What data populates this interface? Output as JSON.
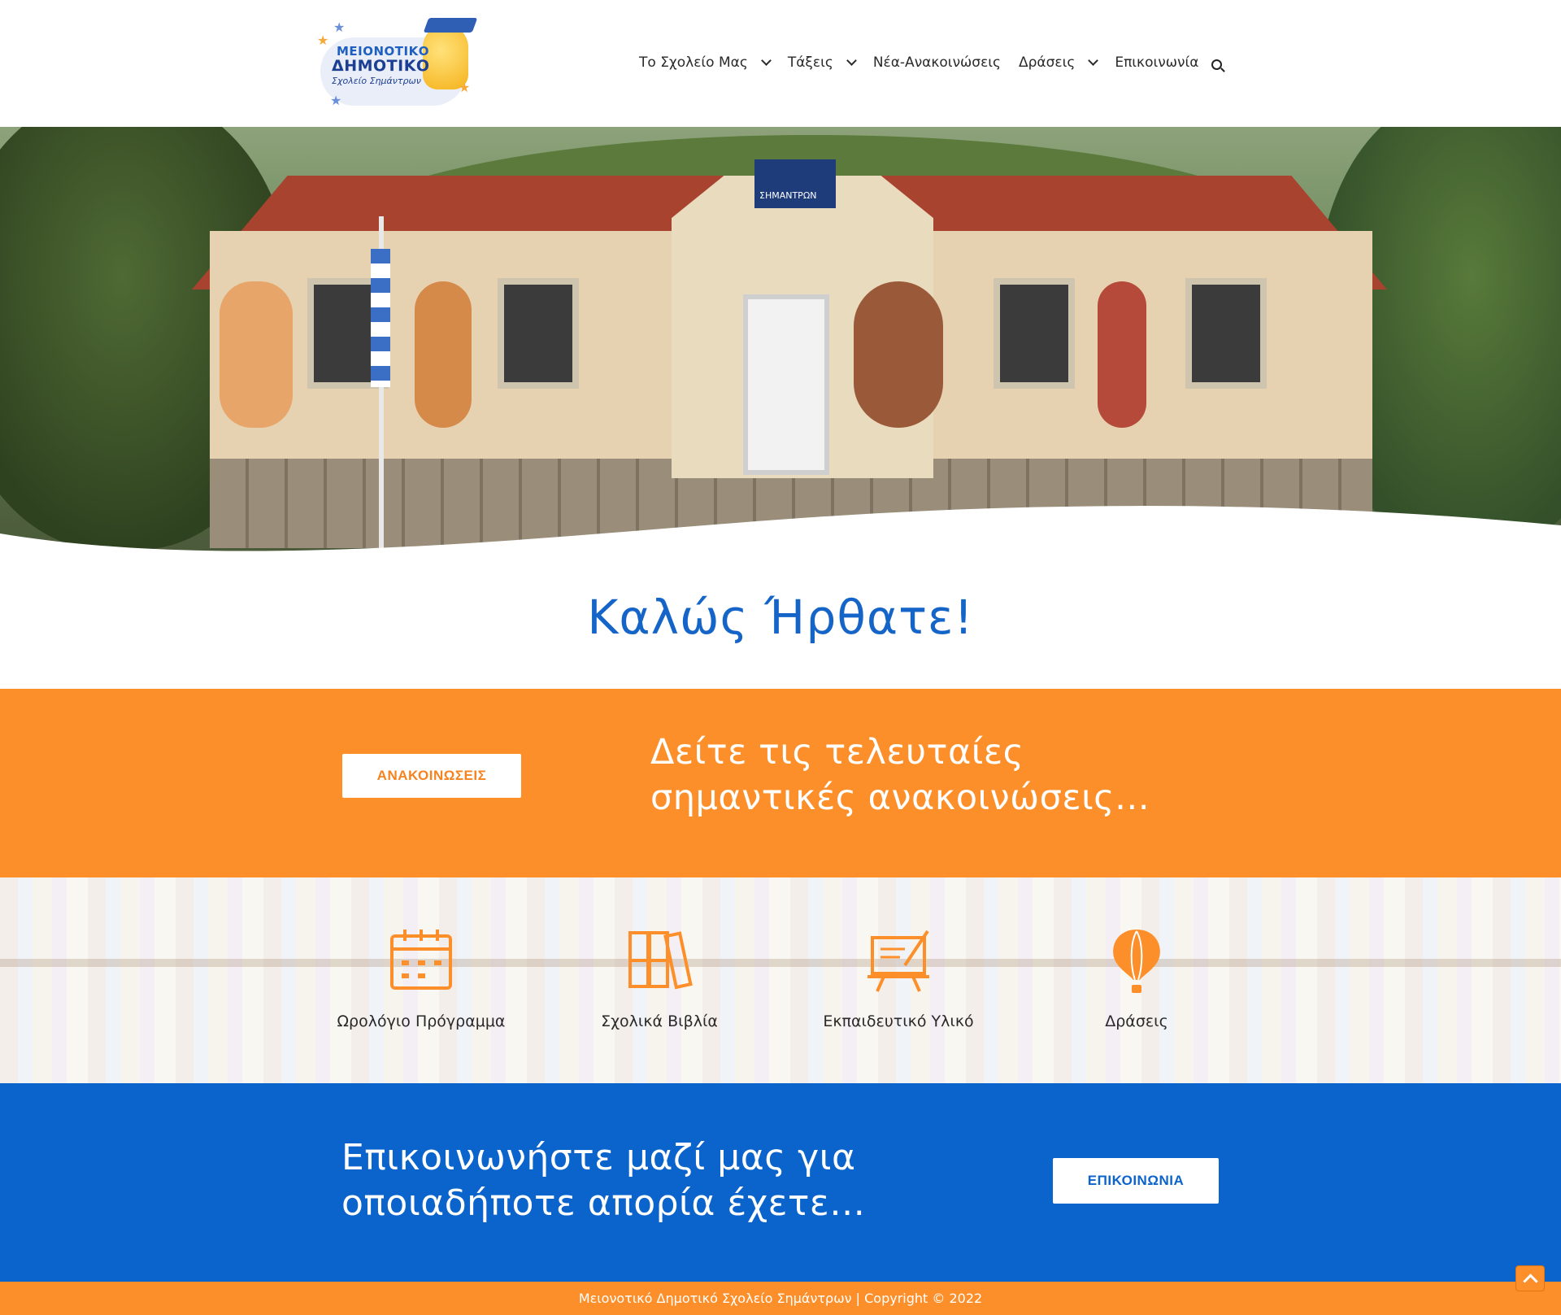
{
  "header": {
    "logo": {
      "line1": "ΜΕΙΟΝΟΤΙΚΟ",
      "line2": "ΔΗΜΟΤΙΚΟ",
      "line3": "Σχολείο Σημάντρων"
    },
    "nav": [
      {
        "label": "Το Σχολείο Μας",
        "has_dropdown": true
      },
      {
        "label": "Τάξεις",
        "has_dropdown": true
      },
      {
        "label": "Νέα-Ανακοινώσεις",
        "has_dropdown": false
      },
      {
        "label": "Δράσεις",
        "has_dropdown": true
      },
      {
        "label": "Επικοινωνία",
        "has_dropdown": false
      }
    ],
    "search_icon": "search-icon"
  },
  "hero": {
    "sign_text": "ΣΗΜΑΝΤΡΩΝ"
  },
  "welcome": {
    "title": "Καλώς Ήρθατε!"
  },
  "announcements": {
    "button_label": "ΑΝΑΚΟΙΝΩΣΕΙΣ",
    "text": "Δείτε τις τελευταίες σημαντικές ανακοινώσεις…"
  },
  "quick_links": [
    {
      "label": "Ωρολόγιο Πρόγραμμα",
      "icon": "calendar-icon"
    },
    {
      "label": "Σχολικά Βιβλία",
      "icon": "books-icon"
    },
    {
      "label": "Εκπαιδευτικό Υλικό",
      "icon": "presentation-board-icon"
    },
    {
      "label": "Δράσεις",
      "icon": "hot-air-balloon-icon"
    }
  ],
  "contact": {
    "text": "Επικοινωνήστε μαζί μας για οποιαδήποτε απορία έχετε…",
    "button_label": "ΕΠΙΚΟΙΝΩΝΙΑ"
  },
  "footer": {
    "text": "Μειονοτικό Δημοτικό Σχολείο Σημάντρων | Copyright © 2022"
  },
  "colors": {
    "orange": "#fd8f2a",
    "blue": "#0b63cc",
    "title_blue": "#1565c8"
  }
}
